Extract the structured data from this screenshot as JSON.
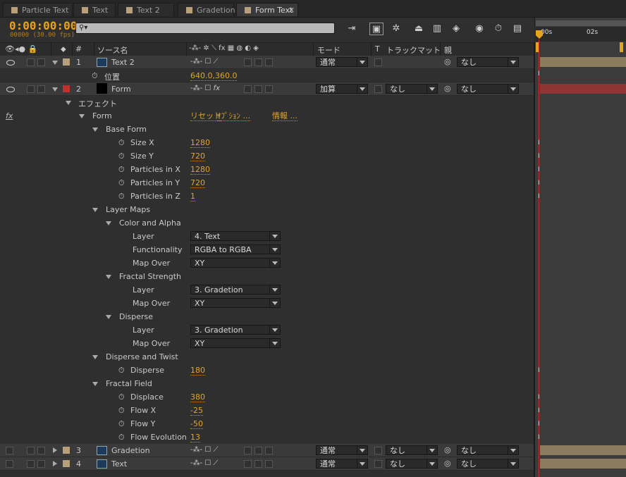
{
  "tabs": [
    {
      "label": "Particle Text",
      "active": false
    },
    {
      "label": "Text",
      "active": false
    },
    {
      "label": "Text 2",
      "active": false
    },
    {
      "label": "Gradetion",
      "active": false
    },
    {
      "label": "Form Text",
      "active": true
    }
  ],
  "timecode": "0:00:00:00",
  "fps": "00000 (30.00 fps)",
  "search": {
    "placeholder": ""
  },
  "headers": {
    "source_name": "ソース名",
    "mode": "モード",
    "t": "T",
    "trackmatte": "トラックマット",
    "parent": "親",
    "num": "#"
  },
  "ruler": {
    "start": "00s",
    "mark": "02s"
  },
  "layers": {
    "l1": {
      "num": "1",
      "name": "Text 2",
      "mode": "通常",
      "parent": "なし",
      "pos_label": "位置",
      "pos_value": "640.0,360.0"
    },
    "l2": {
      "num": "2",
      "name": "Form",
      "mode": "加算",
      "trackmatte": "なし",
      "parent": "なし"
    },
    "l3": {
      "num": "3",
      "name": "Gradetion",
      "mode": "通常",
      "trackmatte": "なし",
      "parent": "なし"
    },
    "l4": {
      "num": "4",
      "name": "Text",
      "mode": "通常",
      "trackmatte": "なし",
      "parent": "なし"
    }
  },
  "effects": {
    "label": "エフェクト",
    "form": "Form",
    "reset": "リセット",
    "options": "ｵﾌﾟｼｮﾝ ...",
    "about": "情報 ...",
    "base_form": "Base Form",
    "size_x": {
      "label": "Size X",
      "value": "1280"
    },
    "size_y": {
      "label": "Size Y",
      "value": "720"
    },
    "pix": {
      "label": "Particles in X",
      "value": "1280"
    },
    "piy": {
      "label": "Particles in Y",
      "value": "720"
    },
    "piz": {
      "label": "Particles in Z",
      "value": "1"
    },
    "layer_maps": "Layer Maps",
    "color_alpha": "Color and Alpha",
    "ca_layer": {
      "label": "Layer",
      "value": "4. Text"
    },
    "ca_func": {
      "label": "Functionality",
      "value": "RGBA to RGBA"
    },
    "ca_mapover": {
      "label": "Map Over",
      "value": "XY"
    },
    "fractal_strength": "Fractal Strength",
    "fs_layer": {
      "label": "Layer",
      "value": "3. Gradetion"
    },
    "fs_mapover": {
      "label": "Map Over",
      "value": "XY"
    },
    "disperse_grp": "Disperse",
    "d_layer": {
      "label": "Layer",
      "value": "3. Gradetion"
    },
    "d_mapover": {
      "label": "Map Over",
      "value": "XY"
    },
    "disperse_twist": "Disperse and Twist",
    "disperse": {
      "label": "Disperse",
      "value": "180"
    },
    "fractal_field": "Fractal Field",
    "displace": {
      "label": "Displace",
      "value": "380"
    },
    "flow_x": {
      "label": "Flow X",
      "value": "-25"
    },
    "flow_y": {
      "label": "Flow Y",
      "value": "-50"
    },
    "flow_evo": {
      "label": "Flow Evolution",
      "value": "13"
    }
  },
  "colors": {
    "accent": "#e8a31e",
    "layer2_label": "#c0302f",
    "layer_tan": "#b8a07a",
    "playhead": "#c02b2b"
  }
}
